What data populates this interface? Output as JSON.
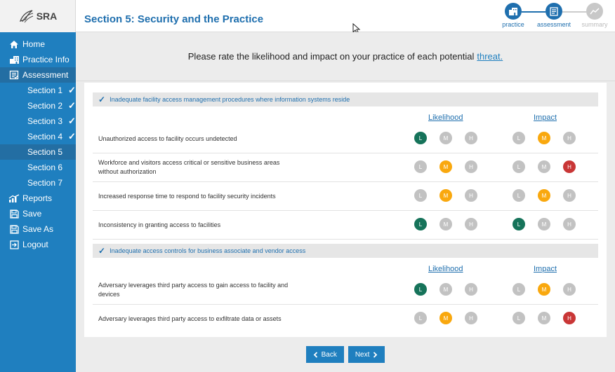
{
  "app": {
    "logo_text": "SRA"
  },
  "sidebar": {
    "items": [
      {
        "label": "Home",
        "icon": "home-icon"
      },
      {
        "label": "Practice Info",
        "icon": "building-icon"
      },
      {
        "label": "Assessment",
        "icon": "clipboard-icon"
      }
    ],
    "sections": [
      {
        "label": "Section 1",
        "done": true
      },
      {
        "label": "Section 2",
        "done": true
      },
      {
        "label": "Section 3",
        "done": true
      },
      {
        "label": "Section 4",
        "done": true
      },
      {
        "label": "Section 5",
        "done": false,
        "active": true
      },
      {
        "label": "Section 6",
        "done": false
      },
      {
        "label": "Section 7",
        "done": false
      }
    ],
    "bottom_items": [
      {
        "label": "Reports",
        "icon": "chart-icon"
      },
      {
        "label": "Save",
        "icon": "save-icon"
      },
      {
        "label": "Save As",
        "icon": "save-as-icon"
      },
      {
        "label": "Logout",
        "icon": "logout-icon"
      }
    ],
    "check_mark": "✓"
  },
  "header": {
    "title": "Section 5: Security and the Practice",
    "steps": [
      {
        "label": "practice",
        "state": "done"
      },
      {
        "label": "assessment",
        "state": "current"
      },
      {
        "label": "summary",
        "state": "pending"
      }
    ]
  },
  "prompt": {
    "text": "Please rate the likelihood and impact on your practice of each potential",
    "link": "threat."
  },
  "columns": {
    "likelihood": "Likelihood",
    "impact": "Impact"
  },
  "rating_letters": [
    "L",
    "M",
    "H"
  ],
  "groups": [
    {
      "title": "Inadequate facility access management procedures where information systems reside",
      "rows": [
        {
          "text": "Unauthorized access to facility occurs undetected",
          "likelihood": "L",
          "impact": "M"
        },
        {
          "text": "Workforce and visitors access critical or sensitive business areas without authorization",
          "likelihood": "M",
          "impact": "H"
        },
        {
          "text": "Increased response time to respond to facility security incidents",
          "likelihood": "M",
          "impact": "M"
        },
        {
          "text": "Inconsistency in granting access to facilities",
          "likelihood": "L",
          "impact": "L"
        }
      ]
    },
    {
      "title": "Inadequate access controls for business associate and vendor access",
      "rows": [
        {
          "text": "Adversary leverages third party access to gain access to facility and devices",
          "likelihood": "L",
          "impact": "M"
        },
        {
          "text": "Adversary leverages third party access to exfiltrate data or assets",
          "likelihood": "M",
          "impact": "H"
        }
      ]
    }
  ],
  "footer": {
    "back_label": "Back",
    "next_label": "Next"
  },
  "colors": {
    "sidebar": "#1f7fbf",
    "low": "#16735a",
    "medium": "#f9a80e",
    "high": "#c93636",
    "unselected": "#c2c2c2"
  }
}
